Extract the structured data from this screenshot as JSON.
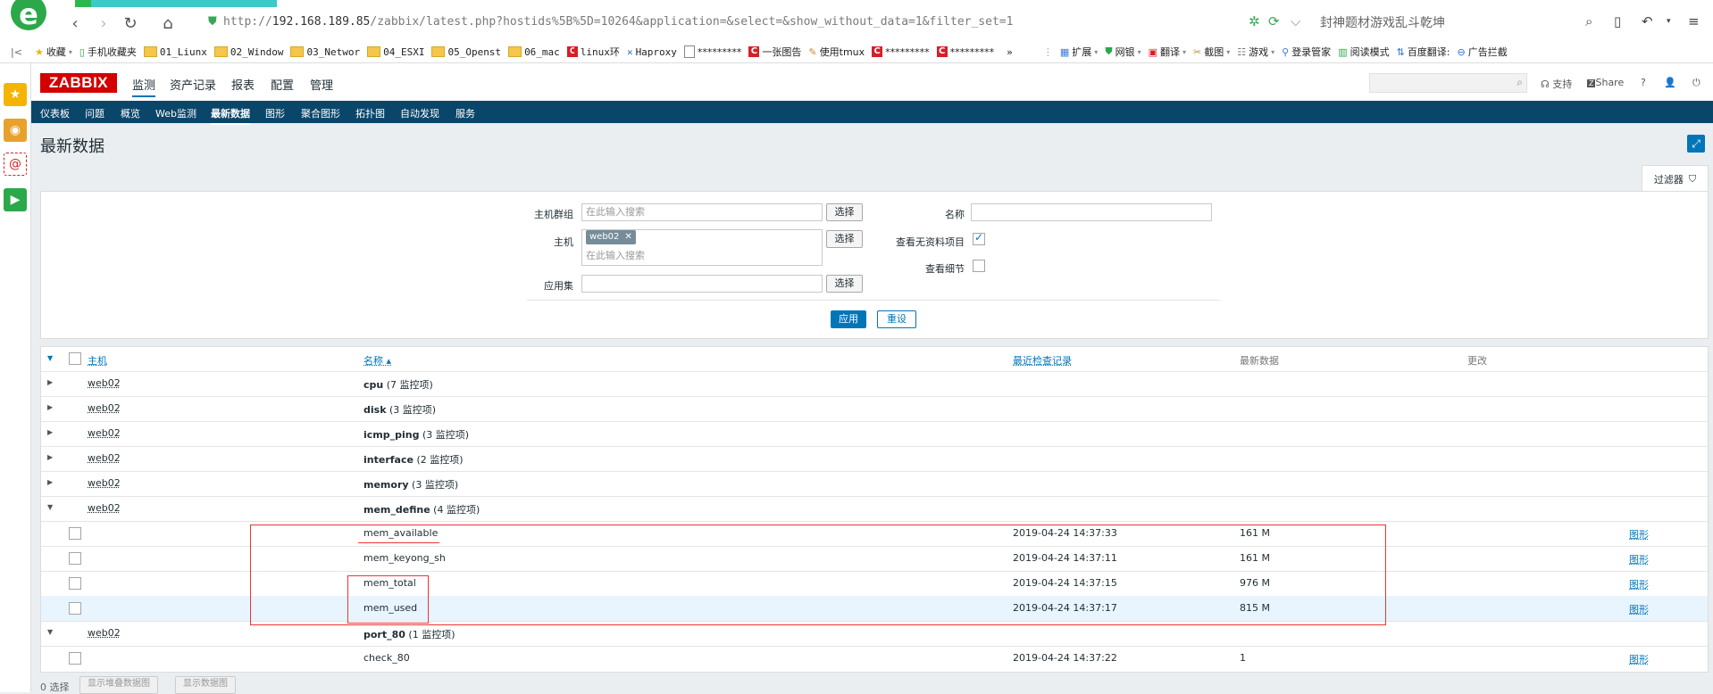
{
  "browser": {
    "url_prefix": "http://",
    "url_host": "192.168.189.85",
    "url_rest": "/zabbix/latest.php?hostids%5B%5D=10264&application=&select=&show_without_data=1&filter_set=1",
    "search_text": "封神题材游戏乱斗乾坤",
    "bookmarks": [
      "收藏",
      "手机收藏夹",
      "01_Liunx",
      "02_Window",
      "03_Networ",
      "04_ESXI",
      "05_Openst",
      "06_mac",
      "linux环",
      "Haproxy",
      "*********",
      "一张图告",
      "使用tmux",
      "*********",
      "*********",
      "»"
    ],
    "right_tools": [
      "扩展",
      "网银",
      "翻译",
      "截图",
      "游戏",
      "登录管家",
      "阅读模式",
      "百度翻译:",
      "广告拦截"
    ]
  },
  "zabbix": {
    "logo": "ZABBIX",
    "top_menu": [
      "监测",
      "资产记录",
      "报表",
      "配置",
      "管理"
    ],
    "support": "支持",
    "share": "Share",
    "help": "?",
    "sub_menu": [
      "仪表板",
      "问题",
      "概览",
      "Web监测",
      "最新数据",
      "图形",
      "聚合图形",
      "拓扑图",
      "自动发现",
      "服务"
    ],
    "page_title": "最新数据"
  },
  "filter": {
    "tab_label": "过滤器",
    "host_group_label": "主机群组",
    "host_label": "主机",
    "app_label": "应用集",
    "name_label": "名称",
    "show_without_data_label": "查看无资料项目",
    "show_details_label": "查看细节",
    "placeholder": "在此输入搜索",
    "select_btn": "选择",
    "host_chip": "web02",
    "apply": "应用",
    "reset": "重设"
  },
  "table": {
    "headers": {
      "host": "主机",
      "name": "名称 ▴",
      "last_check": "最近检查记录",
      "last_value": "最新数据",
      "change": "更改"
    },
    "groups": [
      {
        "host": "web02",
        "name": "cpu",
        "count": "(7 监控项)",
        "expanded": false
      },
      {
        "host": "web02",
        "name": "disk",
        "count": "(3 监控项)",
        "expanded": false
      },
      {
        "host": "web02",
        "name": "icmp_ping",
        "count": "(3 监控项)",
        "expanded": false
      },
      {
        "host": "web02",
        "name": "interface",
        "count": "(2 监控项)",
        "expanded": false
      },
      {
        "host": "web02",
        "name": "memory",
        "count": "(3 监控项)",
        "expanded": false
      },
      {
        "host": "web02",
        "name": "mem_define",
        "count": "(4 监控项)",
        "expanded": true
      },
      {
        "host": "web02",
        "name": "port_80",
        "count": "(1 监控项)",
        "expanded": true
      }
    ],
    "items": [
      {
        "name": "mem_available",
        "time": "2019-04-24 14:37:33",
        "value": "161 M",
        "link": "图形"
      },
      {
        "name": "mem_keyong_sh",
        "time": "2019-04-24 14:37:11",
        "value": "161 M",
        "link": "图形"
      },
      {
        "name": "mem_total",
        "time": "2019-04-24 14:37:15",
        "value": "976 M",
        "link": "图形"
      },
      {
        "name": "mem_used",
        "time": "2019-04-24 14:37:17",
        "value": "815 M",
        "link": "图形"
      },
      {
        "name": "check_80",
        "time": "2019-04-24 14:37:22",
        "value": "1",
        "link": "图形"
      }
    ]
  },
  "footer": {
    "selected": "0 选择",
    "btn_stacked": "显示堆叠数据图",
    "btn_graph": "显示数据图"
  }
}
